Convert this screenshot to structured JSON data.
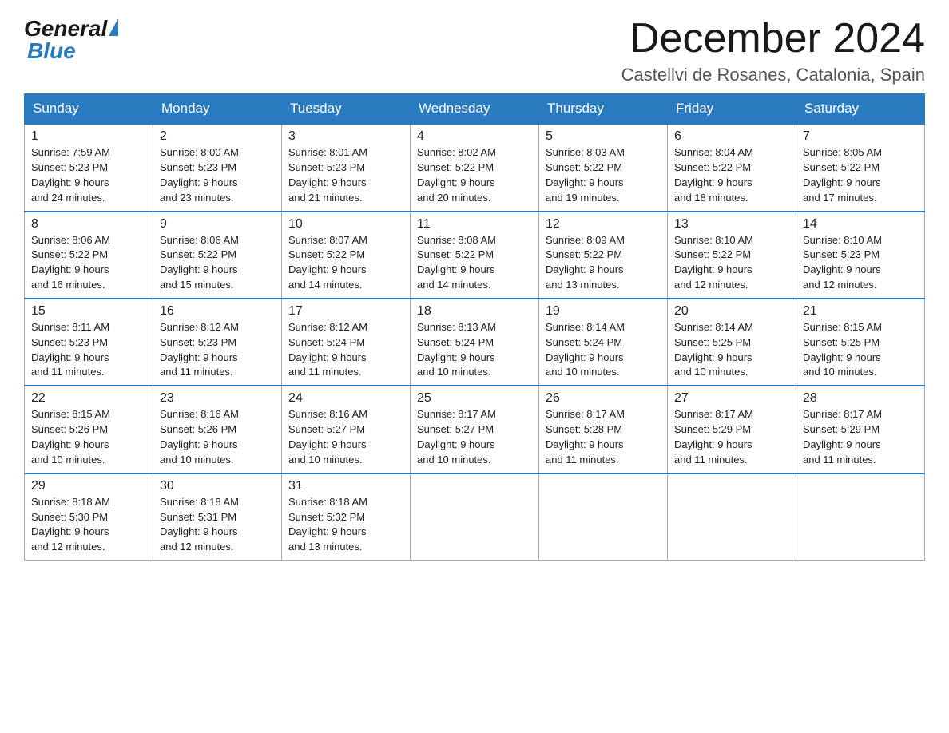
{
  "header": {
    "logo_general": "General",
    "logo_blue": "Blue",
    "title": "December 2024",
    "location": "Castellvi de Rosanes, Catalonia, Spain"
  },
  "days_of_week": [
    "Sunday",
    "Monday",
    "Tuesday",
    "Wednesday",
    "Thursday",
    "Friday",
    "Saturday"
  ],
  "weeks": [
    [
      {
        "day": "1",
        "sunrise": "7:59 AM",
        "sunset": "5:23 PM",
        "daylight": "9 hours and 24 minutes."
      },
      {
        "day": "2",
        "sunrise": "8:00 AM",
        "sunset": "5:23 PM",
        "daylight": "9 hours and 23 minutes."
      },
      {
        "day": "3",
        "sunrise": "8:01 AM",
        "sunset": "5:23 PM",
        "daylight": "9 hours and 21 minutes."
      },
      {
        "day": "4",
        "sunrise": "8:02 AM",
        "sunset": "5:22 PM",
        "daylight": "9 hours and 20 minutes."
      },
      {
        "day": "5",
        "sunrise": "8:03 AM",
        "sunset": "5:22 PM",
        "daylight": "9 hours and 19 minutes."
      },
      {
        "day": "6",
        "sunrise": "8:04 AM",
        "sunset": "5:22 PM",
        "daylight": "9 hours and 18 minutes."
      },
      {
        "day": "7",
        "sunrise": "8:05 AM",
        "sunset": "5:22 PM",
        "daylight": "9 hours and 17 minutes."
      }
    ],
    [
      {
        "day": "8",
        "sunrise": "8:06 AM",
        "sunset": "5:22 PM",
        "daylight": "9 hours and 16 minutes."
      },
      {
        "day": "9",
        "sunrise": "8:06 AM",
        "sunset": "5:22 PM",
        "daylight": "9 hours and 15 minutes."
      },
      {
        "day": "10",
        "sunrise": "8:07 AM",
        "sunset": "5:22 PM",
        "daylight": "9 hours and 14 minutes."
      },
      {
        "day": "11",
        "sunrise": "8:08 AM",
        "sunset": "5:22 PM",
        "daylight": "9 hours and 14 minutes."
      },
      {
        "day": "12",
        "sunrise": "8:09 AM",
        "sunset": "5:22 PM",
        "daylight": "9 hours and 13 minutes."
      },
      {
        "day": "13",
        "sunrise": "8:10 AM",
        "sunset": "5:22 PM",
        "daylight": "9 hours and 12 minutes."
      },
      {
        "day": "14",
        "sunrise": "8:10 AM",
        "sunset": "5:23 PM",
        "daylight": "9 hours and 12 minutes."
      }
    ],
    [
      {
        "day": "15",
        "sunrise": "8:11 AM",
        "sunset": "5:23 PM",
        "daylight": "9 hours and 11 minutes."
      },
      {
        "day": "16",
        "sunrise": "8:12 AM",
        "sunset": "5:23 PM",
        "daylight": "9 hours and 11 minutes."
      },
      {
        "day": "17",
        "sunrise": "8:12 AM",
        "sunset": "5:24 PM",
        "daylight": "9 hours and 11 minutes."
      },
      {
        "day": "18",
        "sunrise": "8:13 AM",
        "sunset": "5:24 PM",
        "daylight": "9 hours and 10 minutes."
      },
      {
        "day": "19",
        "sunrise": "8:14 AM",
        "sunset": "5:24 PM",
        "daylight": "9 hours and 10 minutes."
      },
      {
        "day": "20",
        "sunrise": "8:14 AM",
        "sunset": "5:25 PM",
        "daylight": "9 hours and 10 minutes."
      },
      {
        "day": "21",
        "sunrise": "8:15 AM",
        "sunset": "5:25 PM",
        "daylight": "9 hours and 10 minutes."
      }
    ],
    [
      {
        "day": "22",
        "sunrise": "8:15 AM",
        "sunset": "5:26 PM",
        "daylight": "9 hours and 10 minutes."
      },
      {
        "day": "23",
        "sunrise": "8:16 AM",
        "sunset": "5:26 PM",
        "daylight": "9 hours and 10 minutes."
      },
      {
        "day": "24",
        "sunrise": "8:16 AM",
        "sunset": "5:27 PM",
        "daylight": "9 hours and 10 minutes."
      },
      {
        "day": "25",
        "sunrise": "8:17 AM",
        "sunset": "5:27 PM",
        "daylight": "9 hours and 10 minutes."
      },
      {
        "day": "26",
        "sunrise": "8:17 AM",
        "sunset": "5:28 PM",
        "daylight": "9 hours and 11 minutes."
      },
      {
        "day": "27",
        "sunrise": "8:17 AM",
        "sunset": "5:29 PM",
        "daylight": "9 hours and 11 minutes."
      },
      {
        "day": "28",
        "sunrise": "8:17 AM",
        "sunset": "5:29 PM",
        "daylight": "9 hours and 11 minutes."
      }
    ],
    [
      {
        "day": "29",
        "sunrise": "8:18 AM",
        "sunset": "5:30 PM",
        "daylight": "9 hours and 12 minutes."
      },
      {
        "day": "30",
        "sunrise": "8:18 AM",
        "sunset": "5:31 PM",
        "daylight": "9 hours and 12 minutes."
      },
      {
        "day": "31",
        "sunrise": "8:18 AM",
        "sunset": "5:32 PM",
        "daylight": "9 hours and 13 minutes."
      },
      null,
      null,
      null,
      null
    ]
  ],
  "labels": {
    "sunrise": "Sunrise:",
    "sunset": "Sunset:",
    "daylight": "Daylight:"
  }
}
